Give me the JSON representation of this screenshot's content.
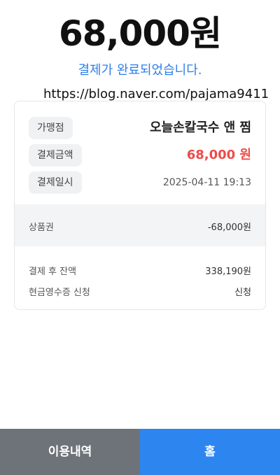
{
  "header": {
    "amount": "68,000원",
    "status": "결제가 완료되었습니다.",
    "watermark_url": "https://blog.naver.com/pajama9411"
  },
  "receipt": {
    "store_label": "가맹점",
    "store_value": "오늘손칼국수 앤 찜",
    "amount_label": "결제금액",
    "amount_value": "68,000 원",
    "date_label": "결제일시",
    "date_value": "2025-04-11 19:13",
    "voucher_label": "상품권",
    "voucher_value": "-68,000원",
    "balance_label": "결제 후 잔액",
    "balance_value": "338,190원",
    "cash_receipt_label": "현금영수증 신청",
    "cash_receipt_value": "신청"
  },
  "buttons": {
    "history_label": "이용내역",
    "home_label": "홈"
  },
  "colors": {
    "accent_blue": "#2f7fe8",
    "amount_red": "#ee4b4b",
    "history_button": "#6d7378",
    "home_button": "#2d85f0"
  }
}
